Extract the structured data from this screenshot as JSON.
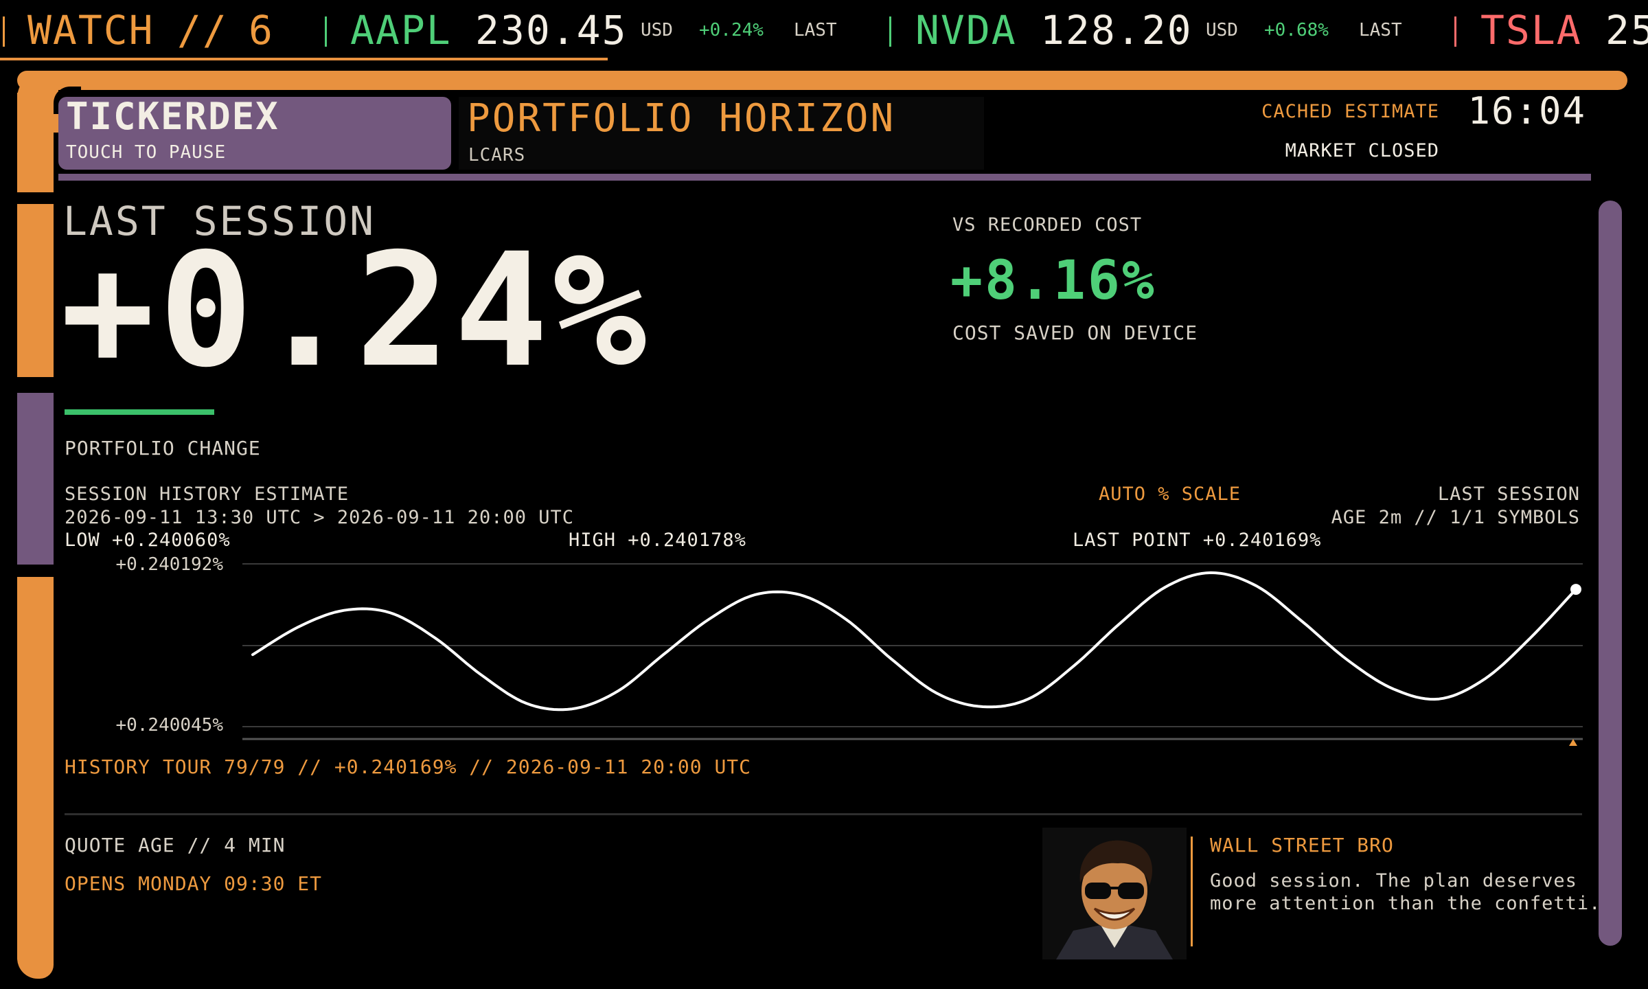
{
  "ticker": {
    "watch_label": "WATCH",
    "watch_sep": "//",
    "watch_count": "6",
    "items": [
      {
        "symbol": "AAPL",
        "price": "230.45",
        "currency": "USD",
        "change": "+0.24%",
        "status": "LAST"
      },
      {
        "symbol": "NVDA",
        "price": "128.20",
        "currency": "USD",
        "change": "+0.68%",
        "status": "LAST"
      },
      {
        "symbol": "TSLA",
        "price": "25"
      }
    ]
  },
  "header": {
    "brand": "TICKERDEX",
    "brand_sub": "TOUCH TO PAUSE",
    "title": "PORTFOLIO HORIZON",
    "subtitle": "LCARS",
    "cache_label": "CACHED ESTIMATE",
    "clock": "16:04",
    "market_status": "MARKET CLOSED"
  },
  "session": {
    "label": "LAST SESSION",
    "value": "+0.24%",
    "caption": "PORTFOLIO CHANGE"
  },
  "vs_cost": {
    "label": "VS RECORDED COST",
    "value": "+8.16%",
    "caption": "COST SAVED ON DEVICE"
  },
  "history": {
    "title": "SESSION HISTORY ESTIMATE",
    "range": "2026-09-11 13:30 UTC > 2026-09-11 20:00 UTC",
    "low": "LOW +0.240060%",
    "high": "HIGH +0.240178%",
    "last_point": "LAST POINT +0.240169%",
    "scale": "AUTO % SCALE",
    "session_label": "LAST SESSION",
    "age": "AGE 2m // 1/1 SYMBOLS",
    "tour": "HISTORY TOUR 79/79 // +0.240169% // 2026-09-11 20:00 UTC"
  },
  "chart_data": {
    "type": "line",
    "ytick_labels": [
      "+0.240192%",
      "+0.240045%"
    ],
    "ylim": [
      0.240045,
      0.240192
    ],
    "grid": true,
    "series": [
      {
        "values": [
          0.24011,
          0.240135,
          0.24015,
          0.240148,
          0.240125,
          0.240092,
          0.240066,
          0.240061,
          0.240077,
          0.24011,
          0.240142,
          0.240164,
          0.240164,
          0.240142,
          0.240106,
          0.240075,
          0.240063,
          0.24007,
          0.2401,
          0.240138,
          0.240171,
          0.240184,
          0.240172,
          0.24014,
          0.240105,
          0.240079,
          0.24007,
          0.240088,
          0.240125,
          0.240169
        ]
      }
    ],
    "colors": {
      "line": "#ffffff",
      "grid": "#3a3a3a",
      "marker": "#ee9a3f"
    }
  },
  "footer": {
    "quote_age": "QUOTE AGE // 4 MIN",
    "opens": "OPENS MONDAY 09:30 ET"
  },
  "advisor": {
    "name": "WALL STREET BRO",
    "message": "Good session. The plan deserves more attention than the confetti."
  },
  "colors": {
    "orange": "#e8913f",
    "purple": "#73587e",
    "green": "#4fcf78",
    "red": "#ff6b6b"
  }
}
